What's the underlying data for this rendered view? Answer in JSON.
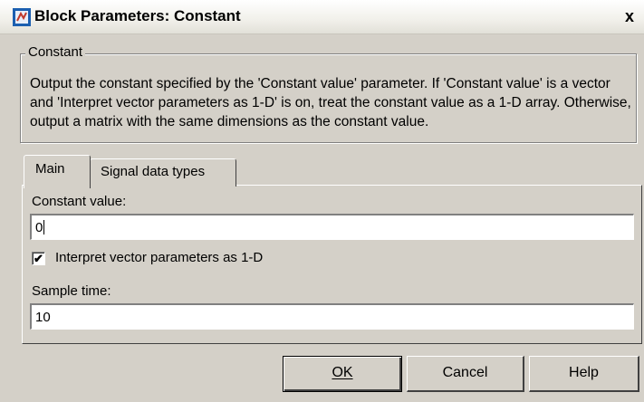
{
  "window": {
    "title": "Block Parameters: Constant",
    "icon": "simulink-block-icon",
    "close_label": "x"
  },
  "group": {
    "legend": "Constant",
    "description": "Output the constant specified by the 'Constant value' parameter. If 'Constant value' is a vector and 'Interpret vector parameters as 1-D' is on, treat the constant value as a 1-D array. Otherwise, output a matrix with the same dimensions as the constant value."
  },
  "tabs": [
    {
      "label": "Main",
      "selected": true
    },
    {
      "label": "Signal data types",
      "selected": false
    }
  ],
  "main": {
    "constant_label": "Constant value:",
    "constant_value": "0",
    "checkbox_label": "Interpret vector parameters as 1-D",
    "checkbox_checked": true,
    "checkbox_glyph": "✔",
    "sample_label": "Sample time:",
    "sample_value": "10"
  },
  "buttons": {
    "ok": "OK",
    "cancel": "Cancel",
    "help": "Help"
  }
}
